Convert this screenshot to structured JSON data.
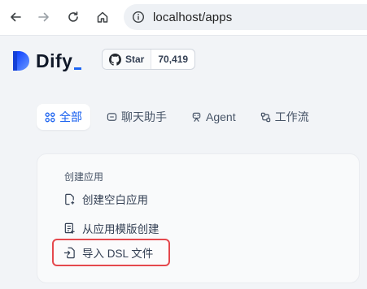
{
  "browser": {
    "url": "localhost/apps",
    "back_icon": "arrow-left-icon",
    "forward_icon": "arrow-right-icon",
    "reload_icon": "reload-icon",
    "home_icon": "home-icon"
  },
  "header": {
    "logo_text": "Dify",
    "github": {
      "label": "Star",
      "count": "70,419"
    }
  },
  "tabs": [
    {
      "label": "全部",
      "icon": "grid-icon",
      "active": true
    },
    {
      "label": "聊天助手",
      "icon": "chat-icon",
      "active": false
    },
    {
      "label": "Agent",
      "icon": "agent-icon",
      "active": false
    },
    {
      "label": "工作流",
      "icon": "workflow-icon",
      "active": false
    }
  ],
  "create_card": {
    "title": "创建应用",
    "items": [
      {
        "label": "创建空白应用",
        "icon": "new-file-icon"
      },
      {
        "label": "从应用模版创建",
        "icon": "template-icon"
      },
      {
        "label": "导入 DSL 文件",
        "icon": "import-file-icon",
        "highlighted": true
      }
    ]
  },
  "colors": {
    "accent": "#155eef",
    "highlight_border": "#e5484d",
    "background": "#f2f4f7"
  }
}
